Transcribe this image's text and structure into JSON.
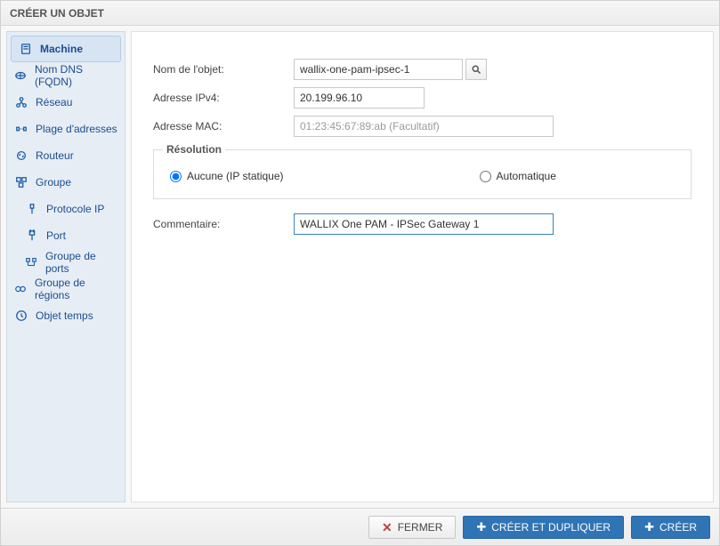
{
  "window": {
    "title": "CRÉER UN OBJET"
  },
  "sidebar": {
    "items": [
      {
        "label": "Machine",
        "icon": "server-icon",
        "active": true
      },
      {
        "label": "Nom DNS (FQDN)",
        "icon": "fqdn-icon"
      },
      {
        "label": "Réseau",
        "icon": "network-icon"
      },
      {
        "label": "Plage d'adresses",
        "icon": "range-icon"
      },
      {
        "label": "Routeur",
        "icon": "router-icon"
      },
      {
        "label": "Groupe",
        "icon": "group-icon"
      },
      {
        "label": "Protocole IP",
        "icon": "protocol-icon",
        "inset": true
      },
      {
        "label": "Port",
        "icon": "port-icon",
        "inset": true
      },
      {
        "label": "Groupe de ports",
        "icon": "portgroup-icon",
        "inset": true
      },
      {
        "label": "Groupe de régions",
        "icon": "regiongroup-icon"
      },
      {
        "label": "Objet temps",
        "icon": "time-icon"
      }
    ]
  },
  "form": {
    "name_label": "Nom de l'objet:",
    "name_value": "wallix-one-pam-ipsec-1",
    "ipv4_label": "Adresse IPv4:",
    "ipv4_value": "20.199.96.10",
    "mac_label": "Adresse MAC:",
    "mac_placeholder": "01:23:45:67:89:ab (Facultatif)",
    "resolution_legend": "Résolution",
    "resolution_static_label": "Aucune (IP statique)",
    "resolution_auto_label": "Automatique",
    "resolution_selected": "static",
    "comment_label": "Commentaire:",
    "comment_value": "WALLIX One PAM - IPSec Gateway 1"
  },
  "footer": {
    "close": "FERMER",
    "create_dup": "CRÉER ET DUPLIQUER",
    "create": "CRÉER"
  }
}
